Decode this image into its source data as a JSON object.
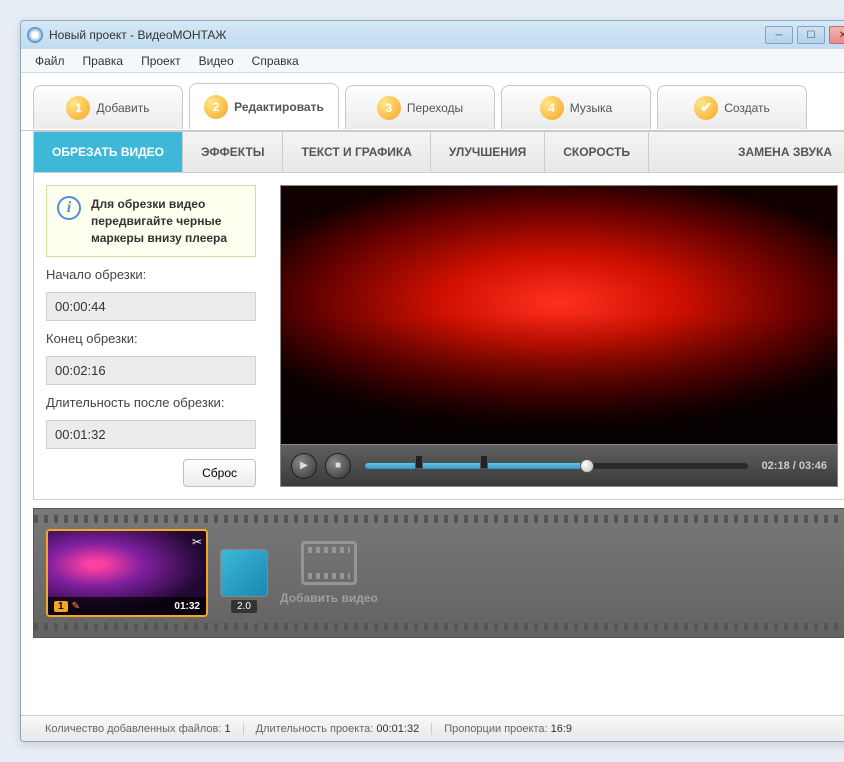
{
  "window": {
    "title": "Новый проект - ВидеоМОНТАЖ"
  },
  "menu": {
    "file": "Файл",
    "edit": "Правка",
    "project": "Проект",
    "video": "Видео",
    "help": "Справка"
  },
  "steps": {
    "add": "Добавить",
    "edit": "Редактировать",
    "transitions": "Переходы",
    "music": "Музыка",
    "create": "Создать",
    "n1": "1",
    "n2": "2",
    "n3": "3",
    "n4": "4",
    "check": "✔"
  },
  "subtabs": {
    "trim": "ОБРЕЗАТЬ ВИДЕО",
    "effects": "ЭФФЕКТЫ",
    "text": "ТЕКСТ И ГРАФИКА",
    "enhance": "УЛУЧШЕНИЯ",
    "speed": "СКОРОСТЬ",
    "audio": "ЗАМЕНА ЗВУКА"
  },
  "trim": {
    "hint": "Для обрезки видео передвигайте черные маркеры внизу плеера",
    "start_label": "Начало обрезки:",
    "start_value": "00:00:44",
    "end_label": "Конец обрезки:",
    "end_value": "00:02:16",
    "duration_label": "Длительность после обрезки:",
    "duration_value": "00:01:32",
    "reset": "Сброс"
  },
  "player": {
    "time": "02:18 / 03:46"
  },
  "timeline": {
    "clip_index": "1",
    "clip_duration": "01:32",
    "transition_duration": "2.0",
    "add_video": "Добавить видео"
  },
  "status": {
    "files_label": "Количество добавленных файлов:",
    "files_value": "1",
    "duration_label": "Длительность проекта:",
    "duration_value": "00:01:32",
    "aspect_label": "Пропорции проекта:",
    "aspect_value": "16:9"
  }
}
